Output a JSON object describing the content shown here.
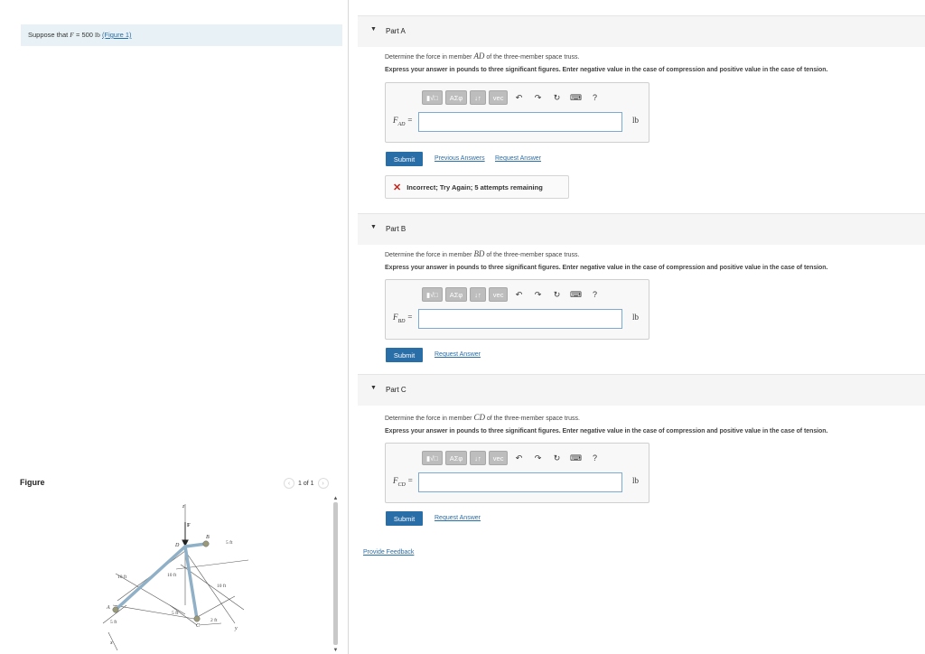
{
  "problem": {
    "prefix": "Suppose that ",
    "var": "F",
    "eq": " = 500 ",
    "unit": "lb",
    "link": "(Figure 1)"
  },
  "figure": {
    "title": "Figure",
    "pager": "1 of 1",
    "labels": {
      "z": "z",
      "F": "F",
      "D": "D",
      "B": "B",
      "A": "A",
      "C": "C",
      "x": "x",
      "y": "y",
      "d10a": "10 ft",
      "d10b": "10 ft",
      "d10c": "10 ft",
      "d5a": "5 ft",
      "d5b": "5 ft",
      "d5c": "5 ft",
      "d2": "2 ft"
    }
  },
  "toolbar": {
    "templates": "▮√□",
    "greek": "ΑΣφ",
    "arrows": "↓↑",
    "vec": "vec",
    "undo": "↶",
    "redo": "↷",
    "reset": "↻",
    "keyboard": "⌨",
    "help": "?"
  },
  "partA": {
    "title": "Part A",
    "q_pre": "Determine the force in member ",
    "q_var": "AD",
    "q_post": " of the three-member space truss.",
    "instr": "Express your answer in pounds to three significant figures. Enter negative value in the case of compression and positive value in the case of tension.",
    "var_main": "F",
    "var_sub": "AD",
    "var_eq": " =",
    "input_value": "",
    "unit": "lb",
    "submit": "Submit",
    "prev_answers": "Previous Answers",
    "request_answer": "Request Answer",
    "feedback": "Incorrect; Try Again; 5 attempts remaining"
  },
  "partB": {
    "title": "Part B",
    "q_pre": "Determine the force in member ",
    "q_var": "BD",
    "q_post": " of the three-member space truss.",
    "instr": "Express your answer in pounds to three significant figures. Enter negative value in the case of compression and positive value in the case of tension.",
    "var_main": "F",
    "var_sub": "BD",
    "var_eq": " =",
    "input_value": "",
    "unit": "lb",
    "submit": "Submit",
    "request_answer": "Request Answer"
  },
  "partC": {
    "title": "Part C",
    "q_pre": "Determine the force in member ",
    "q_var": "CD",
    "q_post": " of the three-member space truss.",
    "instr": "Express your answer in pounds to three significant figures. Enter negative value in the case of compression and positive value in the case of tension.",
    "var_main": "F",
    "var_sub": "CD",
    "var_eq": " =",
    "input_value": "",
    "unit": "lb",
    "submit": "Submit",
    "request_answer": "Request Answer"
  },
  "provide_feedback": "Provide Feedback",
  "colors": {
    "link": "#2a6ea8",
    "error": "#c0261d",
    "banner": "#e8f2f6",
    "member": "#8fb0c6"
  }
}
